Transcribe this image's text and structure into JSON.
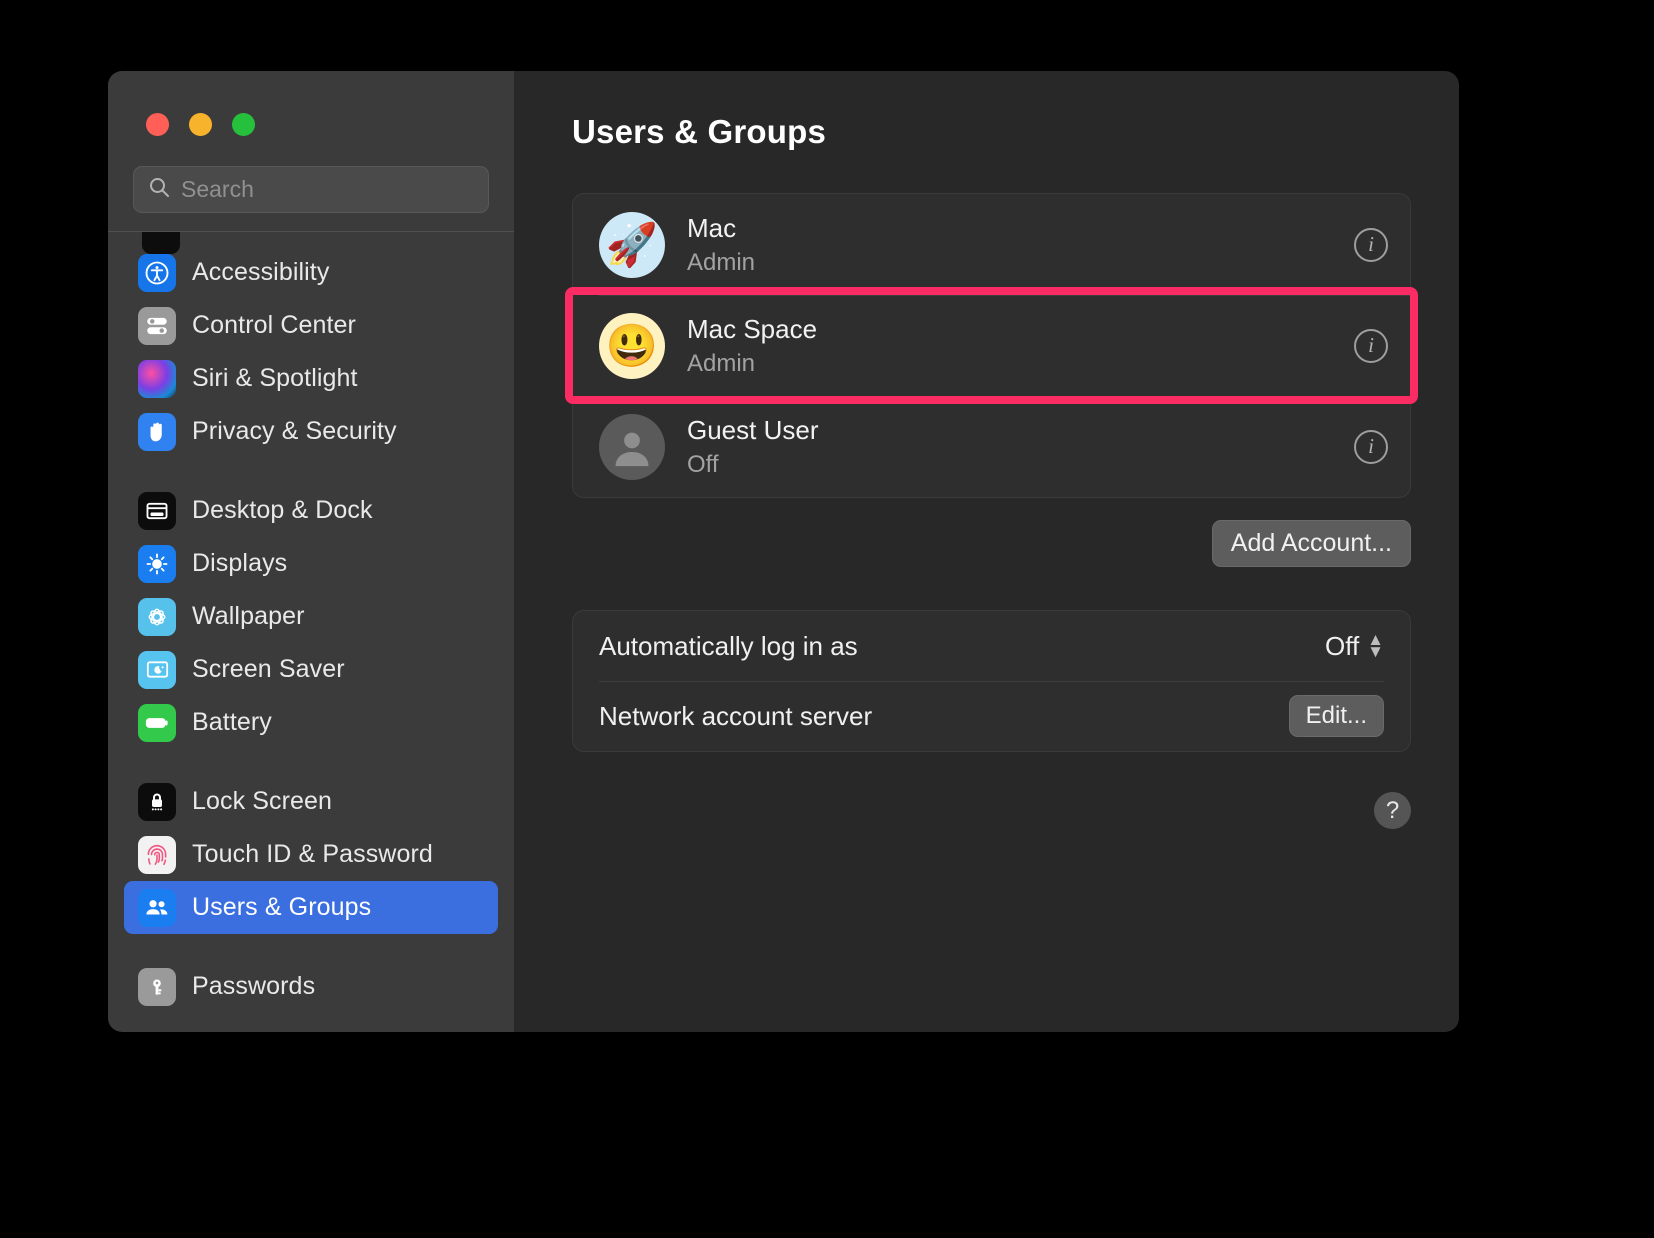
{
  "window": {
    "traffic_lights": [
      {
        "name": "close",
        "color": "#ff5f57"
      },
      {
        "name": "minimize",
        "color": "#f7b32b"
      },
      {
        "name": "zoom",
        "color": "#25c03c"
      }
    ]
  },
  "search": {
    "placeholder": "Search",
    "value": "",
    "icon": "search-icon"
  },
  "sidebar": {
    "groups": [
      {
        "items": [
          {
            "label": "Accessibility",
            "icon": "accessibility-icon",
            "selected": false
          },
          {
            "label": "Control Center",
            "icon": "control-center-icon",
            "selected": false
          },
          {
            "label": "Siri & Spotlight",
            "icon": "siri-icon",
            "selected": false
          },
          {
            "label": "Privacy & Security",
            "icon": "privacy-hand-icon",
            "selected": false
          }
        ]
      },
      {
        "items": [
          {
            "label": "Desktop & Dock",
            "icon": "desktop-dock-icon",
            "selected": false
          },
          {
            "label": "Displays",
            "icon": "displays-sun-icon",
            "selected": false
          },
          {
            "label": "Wallpaper",
            "icon": "wallpaper-icon",
            "selected": false
          },
          {
            "label": "Screen Saver",
            "icon": "screensaver-icon",
            "selected": false
          },
          {
            "label": "Battery",
            "icon": "battery-icon",
            "selected": false
          }
        ]
      },
      {
        "items": [
          {
            "label": "Lock Screen",
            "icon": "lock-icon",
            "selected": false
          },
          {
            "label": "Touch ID & Password",
            "icon": "fingerprint-icon",
            "selected": false
          },
          {
            "label": "Users & Groups",
            "icon": "users-icon",
            "selected": true
          }
        ]
      },
      {
        "items": [
          {
            "label": "Passwords",
            "icon": "key-icon",
            "selected": false
          }
        ]
      }
    ]
  },
  "main": {
    "title": "Users & Groups",
    "users": [
      {
        "name": "Mac",
        "role": "Admin",
        "avatar": "rocket-avatar",
        "avatar_glyph": "🚀",
        "info_label": "i",
        "highlighted": false
      },
      {
        "name": "Mac Space",
        "role": "Admin",
        "avatar": "smiley-avatar",
        "avatar_glyph": "😃",
        "info_label": "i",
        "highlighted": true
      },
      {
        "name": "Guest User",
        "role": "Off",
        "avatar": "guest-avatar",
        "avatar_glyph": "",
        "info_label": "i",
        "highlighted": false
      }
    ],
    "add_account_label": "Add Account...",
    "settings": [
      {
        "label": "Automatically log in as",
        "control": "popup",
        "value": "Off"
      },
      {
        "label": "Network account server",
        "control": "button",
        "value": "Edit..."
      }
    ],
    "help_label": "?"
  },
  "annotation": {
    "color": "#fb2c64",
    "border_width": 8,
    "target": "Mac Space"
  }
}
